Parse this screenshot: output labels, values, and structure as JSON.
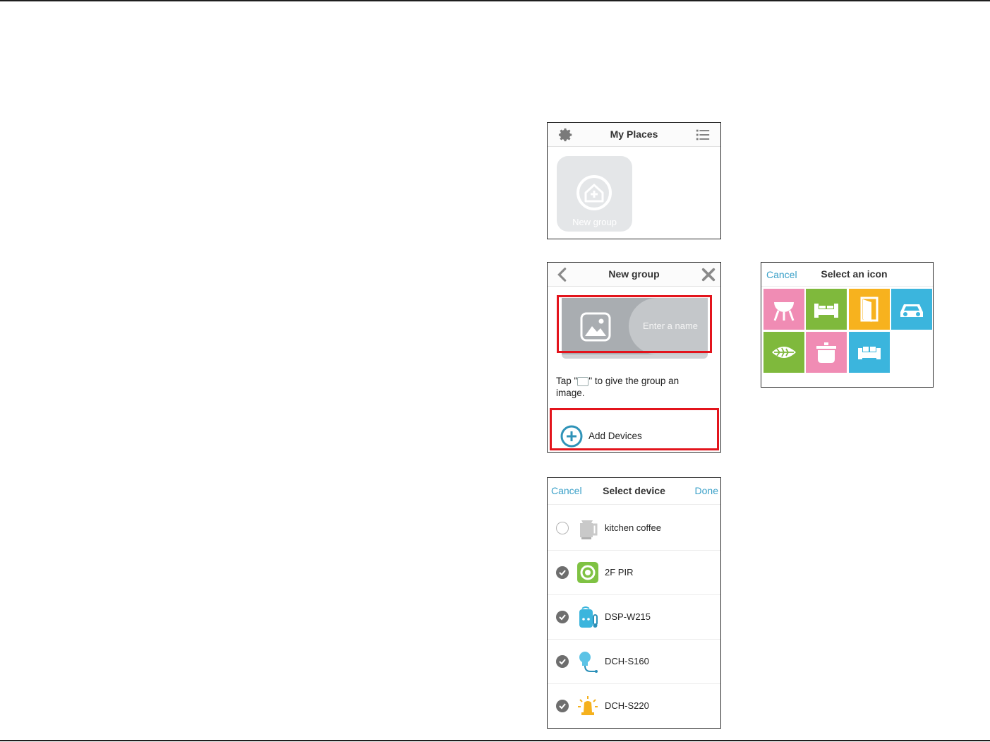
{
  "my_places": {
    "title": "My Places",
    "settings_icon": "gear-icon",
    "menu_icon": "list-icon",
    "new_group_label": "New group"
  },
  "new_group": {
    "title": "New group",
    "back_icon": "chevron-left-icon",
    "close_icon": "close-icon",
    "name_placeholder": "Enter a name",
    "hint_before": "Tap \"",
    "hint_after": "\" to give the group an image.",
    "add_devices_label": "Add Devices"
  },
  "select_icon": {
    "cancel": "Cancel",
    "title": "Select an icon",
    "icons": [
      {
        "name": "grill-icon",
        "color": "#f08cb4"
      },
      {
        "name": "bed-icon",
        "color": "#7fb93c"
      },
      {
        "name": "door-icon",
        "color": "#f7b21e"
      },
      {
        "name": "car-icon",
        "color": "#3bb5dd"
      },
      {
        "name": "leaf-icon",
        "color": "#7fb93c"
      },
      {
        "name": "pot-icon",
        "color": "#f08cb4"
      },
      {
        "name": "sofa-icon",
        "color": "#3bb5dd"
      }
    ]
  },
  "select_device": {
    "cancel": "Cancel",
    "title": "Select device",
    "done": "Done",
    "devices": [
      {
        "name": "kitchen coffee",
        "selected": false,
        "icon": "kettle-icon"
      },
      {
        "name": "2F PIR",
        "selected": true,
        "icon": "motion-sensor-icon"
      },
      {
        "name": "DSP-W215",
        "selected": true,
        "icon": "smart-plug-icon"
      },
      {
        "name": "DCH-S160",
        "selected": true,
        "icon": "water-sensor-icon"
      },
      {
        "name": "DCH-S220",
        "selected": true,
        "icon": "siren-icon"
      }
    ]
  },
  "colors": {
    "accent": "#3aa0c8",
    "highlight": "#e3141c"
  }
}
